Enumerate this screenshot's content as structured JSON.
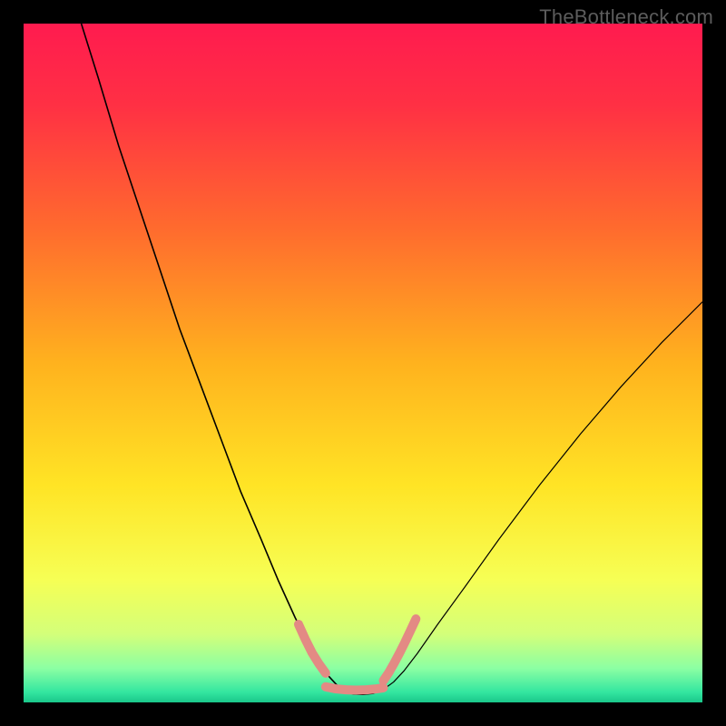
{
  "watermark": "TheBottleneck.com",
  "chart_data": {
    "type": "line",
    "title": "",
    "xlabel": "",
    "ylabel": "",
    "xlim": [
      0,
      100
    ],
    "ylim": [
      0,
      100
    ],
    "gradient_stops": [
      {
        "offset": 0.0,
        "color": "#ff1b4f"
      },
      {
        "offset": 0.12,
        "color": "#ff3044"
      },
      {
        "offset": 0.3,
        "color": "#ff6a2e"
      },
      {
        "offset": 0.5,
        "color": "#ffb21e"
      },
      {
        "offset": 0.68,
        "color": "#ffe425"
      },
      {
        "offset": 0.82,
        "color": "#f6ff55"
      },
      {
        "offset": 0.9,
        "color": "#d3ff7a"
      },
      {
        "offset": 0.95,
        "color": "#8bffa3"
      },
      {
        "offset": 0.985,
        "color": "#33e6a0"
      },
      {
        "offset": 1.0,
        "color": "#1ac78a"
      }
    ],
    "series": [
      {
        "name": "left-branch",
        "color": "#000000",
        "width": 1.6,
        "points": [
          {
            "x": 8.5,
            "y": 100
          },
          {
            "x": 11,
            "y": 92
          },
          {
            "x": 14,
            "y": 82
          },
          {
            "x": 17,
            "y": 73
          },
          {
            "x": 20,
            "y": 64
          },
          {
            "x": 23,
            "y": 55
          },
          {
            "x": 26,
            "y": 47
          },
          {
            "x": 29,
            "y": 39
          },
          {
            "x": 32,
            "y": 31
          },
          {
            "x": 35,
            "y": 24
          },
          {
            "x": 37.5,
            "y": 18
          },
          {
            "x": 40,
            "y": 12.5
          },
          {
            "x": 42,
            "y": 8.5
          },
          {
            "x": 43.5,
            "y": 5.8
          },
          {
            "x": 45,
            "y": 3.8
          },
          {
            "x": 46.3,
            "y": 2.4
          },
          {
            "x": 47.5,
            "y": 1.6
          },
          {
            "x": 48.6,
            "y": 1.2
          }
        ]
      },
      {
        "name": "right-branch",
        "color": "#000000",
        "width": 1.2,
        "points": [
          {
            "x": 48.6,
            "y": 1.2
          },
          {
            "x": 50,
            "y": 1.15
          },
          {
            "x": 51.5,
            "y": 1.3
          },
          {
            "x": 53,
            "y": 1.9
          },
          {
            "x": 54.5,
            "y": 3.0
          },
          {
            "x": 56,
            "y": 4.6
          },
          {
            "x": 58,
            "y": 7.2
          },
          {
            "x": 61,
            "y": 11.5
          },
          {
            "x": 65,
            "y": 17
          },
          {
            "x": 70,
            "y": 24
          },
          {
            "x": 76,
            "y": 32
          },
          {
            "x": 82,
            "y": 39.5
          },
          {
            "x": 88,
            "y": 46.5
          },
          {
            "x": 94,
            "y": 53
          },
          {
            "x": 100,
            "y": 59
          }
        ]
      },
      {
        "name": "peach-marker-left",
        "color": "#e38a84",
        "width": 10,
        "cap": "round",
        "points": [
          {
            "x": 40.5,
            "y": 11.5
          },
          {
            "x": 41.5,
            "y": 9.3
          },
          {
            "x": 42.5,
            "y": 7.3
          },
          {
            "x": 43.5,
            "y": 5.7
          },
          {
            "x": 44.5,
            "y": 4.3
          }
        ]
      },
      {
        "name": "peach-marker-bottom",
        "color": "#e38a84",
        "width": 10,
        "cap": "round",
        "points": [
          {
            "x": 44.5,
            "y": 2.3
          },
          {
            "x": 46,
            "y": 2.0
          },
          {
            "x": 47.5,
            "y": 1.85
          },
          {
            "x": 49,
            "y": 1.8
          },
          {
            "x": 50.5,
            "y": 1.85
          },
          {
            "x": 52,
            "y": 2.0
          },
          {
            "x": 53,
            "y": 2.15
          }
        ]
      },
      {
        "name": "peach-marker-right",
        "color": "#e38a84",
        "width": 10,
        "cap": "round",
        "points": [
          {
            "x": 53.0,
            "y": 3.2
          },
          {
            "x": 53.8,
            "y": 4.4
          },
          {
            "x": 54.6,
            "y": 5.8
          },
          {
            "x": 55.4,
            "y": 7.3
          },
          {
            "x": 56.2,
            "y": 8.9
          },
          {
            "x": 57.0,
            "y": 10.6
          },
          {
            "x": 57.8,
            "y": 12.3
          }
        ]
      }
    ]
  }
}
